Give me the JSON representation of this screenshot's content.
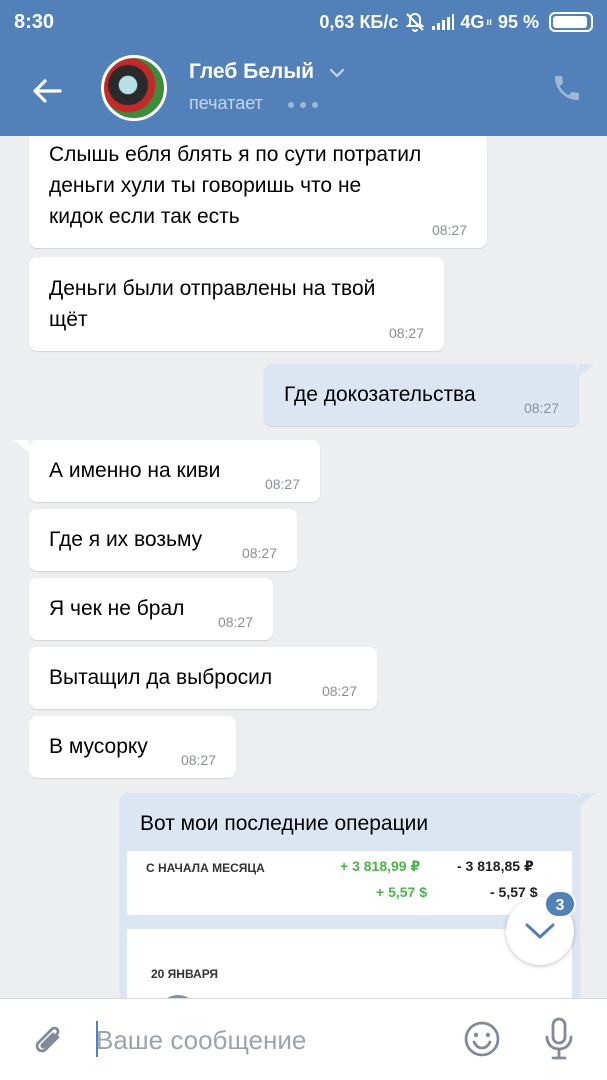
{
  "statusbar": {
    "time": "8:30",
    "network_speed": "0,63 КБ/с",
    "network_type": "4G",
    "network_suffix": "ıı",
    "battery": "95 %",
    "battery_level": 0.95
  },
  "header": {
    "contact_name": "Глеб Белый",
    "status": "печатает",
    "back_icon": "arrow-left-icon",
    "call_icon": "phone-icon",
    "accent": "#5181b8"
  },
  "messages": [
    {
      "direction": "in",
      "text_lines": [
        "Слышь ебля блять я по сути потратил",
        "деньги хули ты говоришь что не",
        "кидок если так есть"
      ],
      "time": "08:27"
    },
    {
      "direction": "in",
      "text_lines": [
        "Деньги были отправлены на твой",
        "щёт"
      ],
      "time": "08:27"
    },
    {
      "direction": "out",
      "text_lines": [
        "Где докозательства"
      ],
      "time": "08:27"
    },
    {
      "direction": "in",
      "text_lines": [
        "А именно на киви"
      ],
      "time": "08:27"
    },
    {
      "direction": "in",
      "text_lines": [
        "Где я их возьму"
      ],
      "time": "08:27"
    },
    {
      "direction": "in",
      "text_lines": [
        "Я чек не брал"
      ],
      "time": "08:27"
    },
    {
      "direction": "in",
      "text_lines": [
        "Вытащил да выбросил"
      ],
      "time": "08:27"
    },
    {
      "direction": "in",
      "text_lines": [
        "В мусорку"
      ],
      "time": "08:27"
    },
    {
      "direction": "out",
      "text_lines": [
        "Вот мои последние операции"
      ],
      "time": ""
    }
  ],
  "attachment": {
    "period_label": "С НАЧАЛА МЕСЯЦА",
    "income_rub": "+ 3 818,99 ₽",
    "expense_rub": "- 3 818,85 ₽",
    "income_usd": "+ 5,57 $",
    "expense_usd": "- 5,57 $",
    "date_label": "20 ЯНВАРЯ",
    "income_color": "#4bb34b"
  },
  "scroll_down": {
    "unread_count": "3",
    "icon": "chevron-down-icon"
  },
  "composer": {
    "placeholder": "Ваше сообщение",
    "attach_icon": "paperclip-icon",
    "emoji_icon": "smile-icon",
    "mic_icon": "microphone-icon"
  }
}
